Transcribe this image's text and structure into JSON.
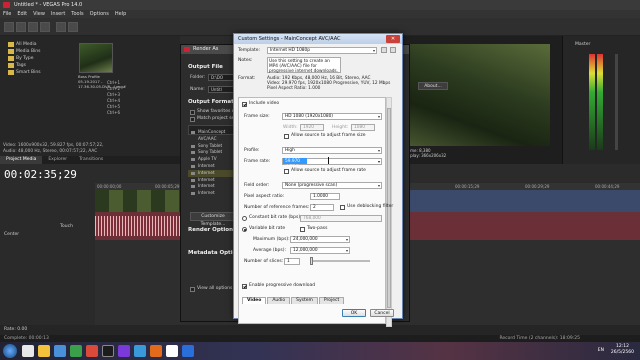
{
  "vegas": {
    "title": "Untitled * - VEGAS Pro 14.0",
    "menu": [
      "File",
      "Edit",
      "View",
      "Insert",
      "Tools",
      "Options",
      "Help"
    ],
    "tree_items": [
      "All Media",
      "Media Bins",
      "By Type",
      "Tags",
      "Smart Bins"
    ],
    "thumb_caption": "Boss Profile 05.19.2017 - 17.36.30.05.DVR...Long#",
    "media_info": [
      "Video: 1600x900x32, 59.827 fps, 00:07:57;22,",
      "Audio: 48,000 Hz, Stereo, 00:07:57;22, AAC"
    ],
    "keys": [
      "Ctrl+1",
      "Ctrl+2",
      "Ctrl+3",
      "Ctrl+4",
      "Ctrl+5",
      "Ctrl+6"
    ],
    "pane_tabs": [
      "Project Media",
      "Explorer",
      "Transitions"
    ],
    "preview_info": [
      "Frame: 8,380",
      "Display: 366x206x32"
    ],
    "master_label": "Master",
    "timecode": "00:02:35;29",
    "track_labels": [
      "Touch",
      "Center"
    ],
    "ruler_ticks": [
      "00:00:00;00",
      "00:00:05;29",
      "00:00:15;29",
      "00:00:29;29",
      "00:00:44;29"
    ],
    "rate_label": "Rate: 0.00",
    "status_left": "Complete: 00:00:13",
    "status_right": "Record Time (2 channels): 18:09:25"
  },
  "render_as": {
    "title": "Render As",
    "output_file": "Output File",
    "folder_label": "Folder:",
    "folder_value": "D:\\DO",
    "name_label": "Name:",
    "name_value": "Untitl",
    "output_format": "Output Format:",
    "options": [
      "Show favorites only",
      "Match project settings"
    ],
    "format_items": [
      "MainConcept AVC/AAC",
      "Sony Tablet",
      "Sony Tablet",
      "Apple TV",
      "Internet",
      "Internet",
      "Internet",
      "Internet",
      "Internet"
    ],
    "customize_button": "Customize Template...",
    "render_options": "Render Options",
    "metadata_options": "Metadata Options",
    "view_all": "View all options",
    "about_button": "About...",
    "browse_button": "Browse..."
  },
  "custom_settings": {
    "title": "Custom Settings - MainConcept AVC/AAC",
    "template_label": "Template:",
    "template_value": "Internet HD 1080p",
    "notes_label": "Notes:",
    "notes_text": "Use this setting to create an MP4 (AVC/AAC) file for progressive internet downloads.",
    "format_label": "Format:",
    "format_text": [
      "Audio: 192 Kbps, 48,000 Hz, 16 Bit, Stereo, AAC",
      "Video: 29.970 fps, 1920x1080 Progressive, YUV, 12 Mbps",
      "Pixel Aspect Ratio: 1.000"
    ],
    "include_video": "Include video",
    "frame_size_label": "Frame size:",
    "frame_size_value": "HD 1080 (1920x1080)",
    "width_label": "Width:",
    "width_value": "1920",
    "height_label": "Height:",
    "height_value": "1080",
    "allow_frame_size": "Allow source to adjust frame size",
    "profile_label": "Profile:",
    "profile_value": "High",
    "frame_rate_label": "Frame rate:",
    "frame_rate_value": "59.970 (NTSC)",
    "allow_frame_rate": "Allow source to adjust frame rate",
    "field_order_label": "Field order:",
    "field_order_value": "None (progressive scan)",
    "par_label": "Pixel aspect ratio:",
    "par_value": "1.0000",
    "ref_frames_label": "Number of reference frames:",
    "ref_frames_value": "2",
    "deblocking": "Use deblocking filter",
    "constant_bit_rate": "Constant bit rate (bps):",
    "constant_value": "768,000",
    "variable_bit_rate": "Variable bit rate",
    "two_pass": "Two-pass",
    "max_label": "Maximum (bps):",
    "max_value": "24,000,000",
    "avg_label": "Average (bps):",
    "avg_value": "12,000,000",
    "slices_label": "Number of slices:",
    "slices_value": "1",
    "progressive_download": "Enable progressive download",
    "tabs": [
      "Video",
      "Audio",
      "System",
      "Project"
    ],
    "ok": "OK",
    "cancel": "Cancel"
  },
  "taskbar": {
    "lang": "EN",
    "time": "12:12",
    "date": "26/5/2560"
  }
}
